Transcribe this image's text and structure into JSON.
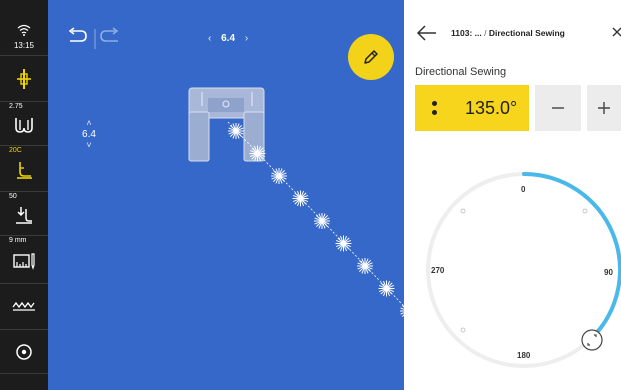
{
  "status": {
    "time": "13:15"
  },
  "rail": {
    "items": [
      {
        "name": "needle-position",
        "value": ""
      },
      {
        "name": "stitch-width",
        "value": "2.75"
      },
      {
        "name": "presser-foot",
        "value": "20C"
      },
      {
        "name": "foot-pressure",
        "value": "50"
      },
      {
        "name": "measurement",
        "value": "9 mm"
      },
      {
        "name": "stitch-pattern",
        "value": ""
      },
      {
        "name": "settings",
        "value": ""
      }
    ]
  },
  "canvas": {
    "zoom_value": "6.4",
    "stitch_length_value": "6.4",
    "edit_button_color": "#f3d31a",
    "background_color": "#3668c9"
  },
  "panel": {
    "breadcrumb_prefix": "1103: ...",
    "breadcrumb_separator": " / ",
    "breadcrumb_current": "Directional Sewing",
    "section_title": "Directional Sewing",
    "angle_value": "135.0°",
    "accent_color": "#f7d51d",
    "dial": {
      "labels": {
        "top": "0",
        "right": "90",
        "bottom": "180",
        "left": "270"
      },
      "arc_color": "#49b9ea"
    }
  }
}
